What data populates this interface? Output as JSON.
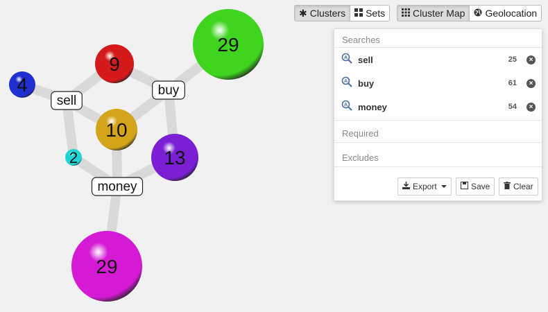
{
  "toolbar": {
    "view_mode": [
      {
        "label": "Clusters",
        "icon": "asterisk-icon",
        "active": true
      },
      {
        "label": "Sets",
        "icon": "grid-icon",
        "active": false
      }
    ],
    "map_mode": [
      {
        "label": "Cluster Map",
        "icon": "apps-grid-icon",
        "active": true
      },
      {
        "label": "Geolocation",
        "icon": "globe-icon",
        "active": false
      }
    ]
  },
  "panel": {
    "searches_title": "Searches",
    "searches": [
      {
        "term": "sell",
        "count": "25"
      },
      {
        "term": "buy",
        "count": "61"
      },
      {
        "term": "money",
        "count": "54"
      }
    ],
    "required_title": "Required",
    "excludes_title": "Excludes",
    "export_label": "Export",
    "save_label": "Save",
    "clear_label": "Clear"
  },
  "cluster_map": {
    "terms": [
      "sell",
      "buy",
      "money"
    ],
    "clusters": [
      {
        "count": "29",
        "color": "#3fd41f",
        "terms": [
          "buy"
        ]
      },
      {
        "count": "9",
        "color": "#d41a1a",
        "terms": [
          "sell",
          "buy"
        ]
      },
      {
        "count": "4",
        "color": "#1f2fd0",
        "terms": [
          "sell"
        ]
      },
      {
        "count": "10",
        "color": "#d4a51a",
        "terms": [
          "sell",
          "buy",
          "money"
        ]
      },
      {
        "count": "13",
        "color": "#7a1fd4",
        "terms": [
          "buy",
          "money"
        ]
      },
      {
        "count": "2",
        "color": "#1fd4d4",
        "terms": [
          "sell",
          "money"
        ]
      },
      {
        "count": "29",
        "color": "#d41ad4",
        "terms": [
          "money"
        ]
      }
    ]
  }
}
